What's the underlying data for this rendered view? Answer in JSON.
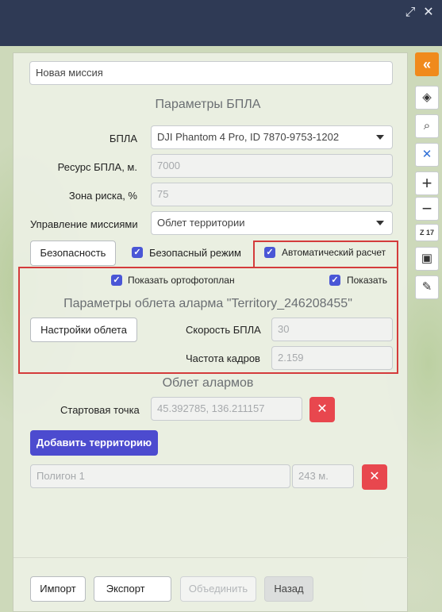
{
  "window": {
    "expand_icon": "expand-icon",
    "close_icon": "close-icon",
    "expand_glyph": "⤢",
    "close_glyph": "✕"
  },
  "mission": {
    "name_value": "Новая миссия"
  },
  "uav_params": {
    "title": "Параметры БПЛА",
    "uav_label": "БПЛА",
    "uav_value": "DJI Phantom 4 Pro, ID 7870-9753-1202",
    "resource_label": "Ресурс БПЛА, м.",
    "resource_value": "7000",
    "risk_label": "Зона риска, %",
    "risk_value": "75",
    "control_label": "Управление миссиями",
    "control_value": "Облет территории",
    "safety_button": "Безопасность",
    "safe_mode_label": "Безопасный режим",
    "auto_calc_label": "Автоматический расчет"
  },
  "alarm_params": {
    "show_ortho_label": "Показать ортофотоплан",
    "show_label": "Показать",
    "title": "Параметры облета аларма  \"Territory_246208455\"",
    "settings_button": "Настройки облета",
    "speed_label": "Скорость БПЛА",
    "speed_value": "30",
    "fps_label": "Частота кадров",
    "fps_value": "2.159"
  },
  "alarm_flight": {
    "title": "Облет алармов",
    "start_label": "Стартовая точка",
    "start_value": "45.392785, 136.211157",
    "add_territory_button": "Добавить территорию",
    "polygon_name": "Полигон 1",
    "polygon_length": "243 м."
  },
  "footer": {
    "import_button": "Импорт",
    "export_button": "Экспорт",
    "merge_button": "Объединить",
    "back_button": "Назад"
  },
  "toolbar": {
    "collapse_glyph": "«",
    "layers_glyph": "◈",
    "search_glyph": "⌕",
    "drone_glyph": "✕",
    "zoom_in_glyph": "+",
    "zoom_out_glyph": "−",
    "zoom_level": "Z 17",
    "save_glyph": "▣",
    "tools_glyph": "✎"
  },
  "colors": {
    "accent": "#4c4bcf",
    "danger": "#e8474e",
    "highlight_frame": "#d43b3b",
    "toolbar_orange": "#f08a1c",
    "topbar": "#2f3a55"
  }
}
